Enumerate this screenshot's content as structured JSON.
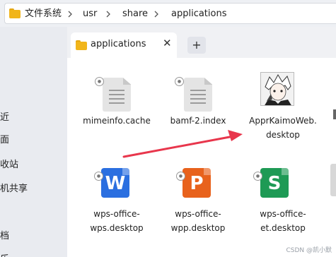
{
  "breadcrumb": {
    "items": [
      "文件系统",
      "usr",
      "share",
      "applications"
    ],
    "separator_icon": "chevron-right-icon"
  },
  "sidebar": {
    "items": [
      "近",
      "面",
      "收站",
      "机共享",
      "档",
      "乐"
    ]
  },
  "tabs": {
    "active_label": "applications",
    "close_glyph": "✕",
    "add_glyph": "+"
  },
  "files": [
    {
      "name_lines": [
        "mimeinfo.cache"
      ],
      "icon": "text-document-icon",
      "locked": true
    },
    {
      "name_lines": [
        "bamf-2.index"
      ],
      "icon": "text-document-icon",
      "locked": true
    },
    {
      "name_lines": [
        "ApprKaimoWeb.",
        "desktop"
      ],
      "icon": "anime-avatar-icon",
      "locked": false
    },
    {
      "name_lines": [
        "wps-office-",
        "wps.desktop"
      ],
      "icon": "wps-writer-icon",
      "letter": "W",
      "locked": true
    },
    {
      "name_lines": [
        "wps-office-",
        "wpp.desktop"
      ],
      "icon": "wps-presentation-icon",
      "letter": "P",
      "locked": true
    },
    {
      "name_lines": [
        "wps-office-",
        "et.desktop"
      ],
      "icon": "wps-spreadsheet-icon",
      "letter": "S",
      "locked": true
    }
  ],
  "colors": {
    "arrow": "#e8364c",
    "wps_writer": "#2b6fe0",
    "wps_presentation": "#e8621c",
    "wps_spreadsheet": "#1e9a55",
    "folder": "#f1b51a"
  },
  "watermark": "CSDN @凯小默"
}
